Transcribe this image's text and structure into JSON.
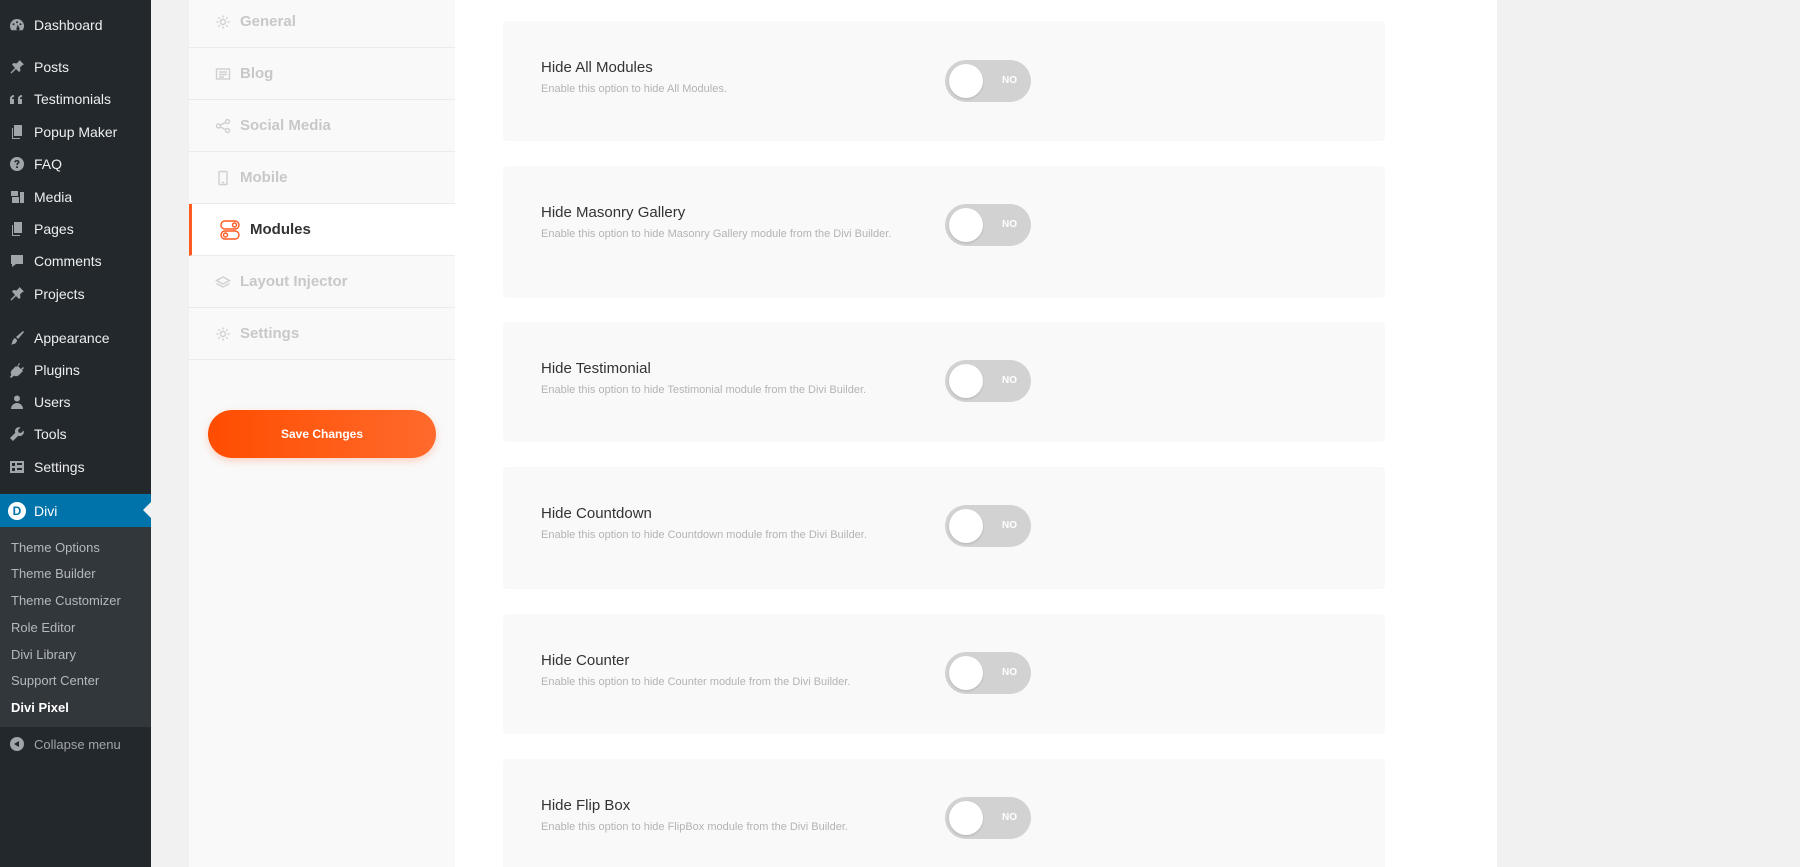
{
  "admin_menu": {
    "items": [
      {
        "label": "Dashboard",
        "icon": "dashboard-icon"
      },
      {
        "label": "Posts",
        "icon": "pin-icon"
      },
      {
        "label": "Testimonials",
        "icon": "quote-icon"
      },
      {
        "label": "Popup Maker",
        "icon": "pages-icon"
      },
      {
        "label": "FAQ",
        "icon": "question-icon"
      },
      {
        "label": "Media",
        "icon": "media-icon"
      },
      {
        "label": "Pages",
        "icon": "pages-icon"
      },
      {
        "label": "Comments",
        "icon": "comment-icon"
      },
      {
        "label": "Projects",
        "icon": "pin-icon"
      },
      {
        "label": "Appearance",
        "icon": "brush-icon"
      },
      {
        "label": "Plugins",
        "icon": "plug-icon"
      },
      {
        "label": "Users",
        "icon": "user-icon"
      },
      {
        "label": "Tools",
        "icon": "wrench-icon"
      },
      {
        "label": "Settings",
        "icon": "settings-icon"
      },
      {
        "label": "Divi",
        "icon": "divi-icon",
        "badge": "D"
      }
    ],
    "submenu": [
      "Theme Options",
      "Theme Builder",
      "Theme Customizer",
      "Role Editor",
      "Divi Library",
      "Support Center",
      "Divi Pixel"
    ],
    "collapse_label": "Collapse menu"
  },
  "plugin_nav": {
    "items": [
      {
        "label": "General",
        "icon": "gear-icon"
      },
      {
        "label": "Blog",
        "icon": "blog-icon"
      },
      {
        "label": "Social Media",
        "icon": "share-icon"
      },
      {
        "label": "Mobile",
        "icon": "mobile-icon"
      },
      {
        "label": "Modules",
        "icon": "modules-icon",
        "active": true
      },
      {
        "label": "Layout Injector",
        "icon": "layers-icon"
      },
      {
        "label": "Settings",
        "icon": "gear-icon"
      }
    ],
    "save_label": "Save Changes"
  },
  "options": [
    {
      "title": "Hide All Modules",
      "desc": "Enable this option to hide All Modules.",
      "toggle": "NO"
    },
    {
      "title": "Hide Masonry Gallery",
      "desc": "Enable this option to hide Masonry Gallery module from the Divi Builder.",
      "toggle": "NO"
    },
    {
      "title": "Hide Testimonial",
      "desc": "Enable this option to hide Testimonial module from the Divi Builder.",
      "toggle": "NO"
    },
    {
      "title": "Hide Countdown",
      "desc": "Enable this option to hide Countdown module from the Divi Builder.",
      "toggle": "NO"
    },
    {
      "title": "Hide Counter",
      "desc": "Enable this option to hide Counter module from the Divi Builder.",
      "toggle": "NO"
    },
    {
      "title": "Hide Flip Box",
      "desc": "Enable this option to hide FlipBox module from the Divi Builder.",
      "toggle": "NO"
    }
  ],
  "colors": {
    "accent": "#ff5a1f",
    "wp_blue": "#0073aa",
    "sidebar_bg": "#23282d"
  }
}
